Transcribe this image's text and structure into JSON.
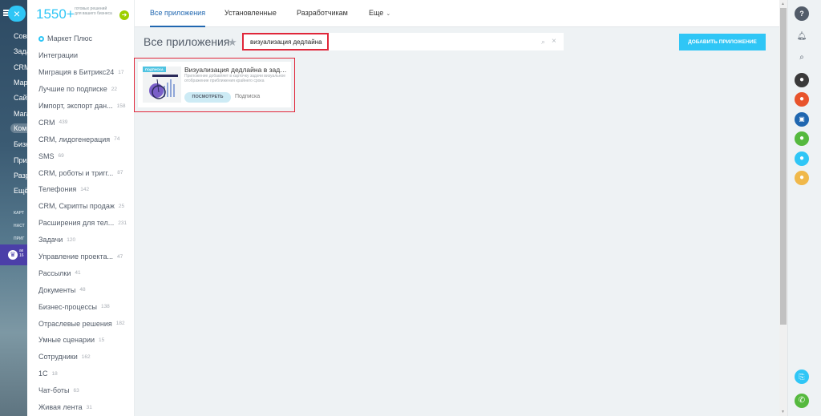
{
  "left_nav": {
    "items": [
      "Совм",
      "Зада",
      "CRM",
      "Марк",
      "Сайт",
      "Мага",
      "Комп",
      "Бизн",
      "Прил",
      "Разр",
      "Ещё"
    ],
    "small_items": [
      "КАРТ",
      "НАСТ",
      "ПРИГ"
    ],
    "crown_text": [
      "ак",
      "16"
    ]
  },
  "promo": {
    "count": "1550+",
    "text": "готовых решений для вашего бизнеса"
  },
  "categories": [
    {
      "label": "Маркет Плюс",
      "count": ""
    },
    {
      "label": "Интеграции",
      "count": ""
    },
    {
      "label": "Миграция в Битрикс24",
      "count": "17"
    },
    {
      "label": "Лучшие по подписке",
      "count": "22"
    },
    {
      "label": "Импорт, экспорт дан...",
      "count": "158"
    },
    {
      "label": "CRM",
      "count": "439"
    },
    {
      "label": "CRM, лидогенерация",
      "count": "74"
    },
    {
      "label": "SMS",
      "count": "69"
    },
    {
      "label": "CRM, роботы и тригг...",
      "count": "87"
    },
    {
      "label": "Телефония",
      "count": "142"
    },
    {
      "label": "CRM, Скрипты продаж",
      "count": "25"
    },
    {
      "label": "Расширения для тел...",
      "count": "231"
    },
    {
      "label": "Задачи",
      "count": "120"
    },
    {
      "label": "Управление проекта...",
      "count": "47"
    },
    {
      "label": "Рассылки",
      "count": "41"
    },
    {
      "label": "Документы",
      "count": "48"
    },
    {
      "label": "Бизнес-процессы",
      "count": "138"
    },
    {
      "label": "Отраслевые решения",
      "count": "182"
    },
    {
      "label": "Умные сценарии",
      "count": "15"
    },
    {
      "label": "Сотрудники",
      "count": "162"
    },
    {
      "label": "1С",
      "count": "18"
    },
    {
      "label": "Чат-боты",
      "count": "63"
    },
    {
      "label": "Живая лента",
      "count": "31"
    }
  ],
  "tabs": [
    "Все приложения",
    "Установленные",
    "Разработчикам",
    "Еще"
  ],
  "page_title": "Все приложения",
  "search": {
    "value": "визуализация дедлайна",
    "placeholder": ""
  },
  "add_button": "ДОБАВИТЬ ПРИЛОЖЕНИЕ",
  "app": {
    "badge": "ПОДПИСКА",
    "title": "Визуализация дедлайна в зада...",
    "description": "Приложение добавляет в карточку задачи визуальное отображение приближения крайнего срока",
    "button": "ПОСМОТРЕТЬ",
    "subscription": "Подписка"
  },
  "colors": {
    "accent": "#2fc6f6",
    "link": "#2067b0",
    "highlight": "#e0273a",
    "green": "#9dcf00"
  },
  "right_panel": {
    "icons": [
      "help-icon",
      "bell-icon",
      "search-icon",
      "user-avatar-1",
      "user-avatar-2",
      "group-chat-icon",
      "user-avatar-3",
      "user-avatar-4",
      "user-avatar-5",
      "screen-share-icon",
      "phone-icon"
    ]
  }
}
